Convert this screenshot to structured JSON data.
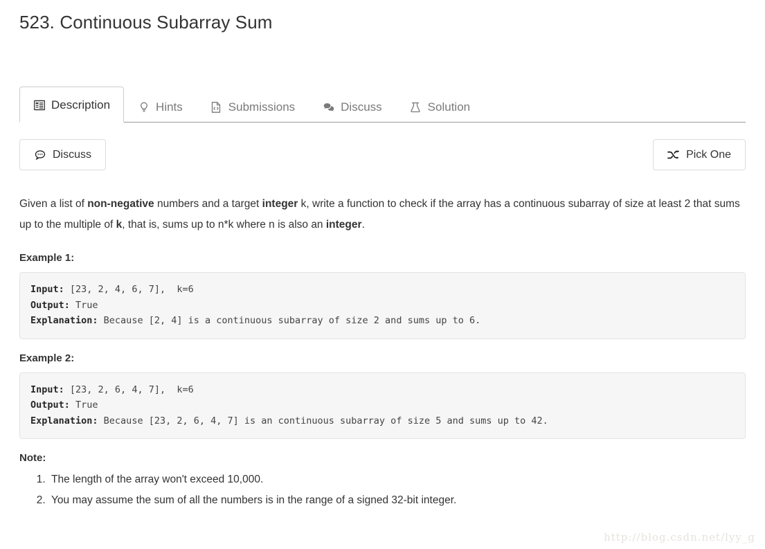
{
  "page": {
    "title": "523. Continuous Subarray Sum"
  },
  "tabs": [
    {
      "label": "Description",
      "icon": "description-list-icon",
      "active": true
    },
    {
      "label": "Hints",
      "icon": "lightbulb-icon",
      "active": false
    },
    {
      "label": "Submissions",
      "icon": "file-code-icon",
      "active": false
    },
    {
      "label": "Discuss",
      "icon": "comments-icon",
      "active": false
    },
    {
      "label": "Solution",
      "icon": "flask-icon",
      "active": false
    }
  ],
  "actions": {
    "discuss_label": "Discuss",
    "discuss_icon": "comment-dots-icon",
    "pick_one_label": "Pick One",
    "pick_one_icon": "shuffle-icon"
  },
  "description": {
    "p1_seg1": "Given a list of ",
    "p1_b1": "non-negative",
    "p1_seg2": " numbers and a target ",
    "p1_b2": "integer",
    "p1_seg3": " k, write a function to check if the array has a continuous subarray of size at least 2 that sums up to the multiple of ",
    "p1_b3": "k",
    "p1_seg4": ", that is, sums up to n*k where n is also an ",
    "p1_b4": "integer",
    "p1_seg5": "."
  },
  "examples": [
    {
      "heading": "Example 1:",
      "input_label": "Input:",
      "input_value": " [23, 2, 4, 6, 7],  k=6",
      "output_label": "Output:",
      "output_value": " True",
      "explanation_label": "Explanation:",
      "explanation_value": " Because [2, 4] is a continuous subarray of size 2 and sums up to 6."
    },
    {
      "heading": "Example 2:",
      "input_label": "Input:",
      "input_value": " [23, 2, 6, 4, 7],  k=6",
      "output_label": "Output:",
      "output_value": " True",
      "explanation_label": "Explanation:",
      "explanation_value": " Because [23, 2, 6, 4, 7] is an continuous subarray of size 5 and sums up to 42."
    }
  ],
  "note": {
    "heading": "Note:",
    "items": [
      "The length of the array won't exceed 10,000.",
      "You may assume the sum of all the numbers is in the range of a signed 32-bit integer."
    ]
  },
  "watermark": {
    "text": "http://blog.csdn.net/lyy_g"
  },
  "colors": {
    "text": "#333333",
    "muted": "#7a7a7a",
    "code_bg": "#f6f6f6",
    "code_border": "#e3e3e3",
    "tab_border": "#cccccc",
    "tabbar_line": "#999999",
    "button_border": "#dcdcdc",
    "watermark": "#e6e3dc"
  }
}
